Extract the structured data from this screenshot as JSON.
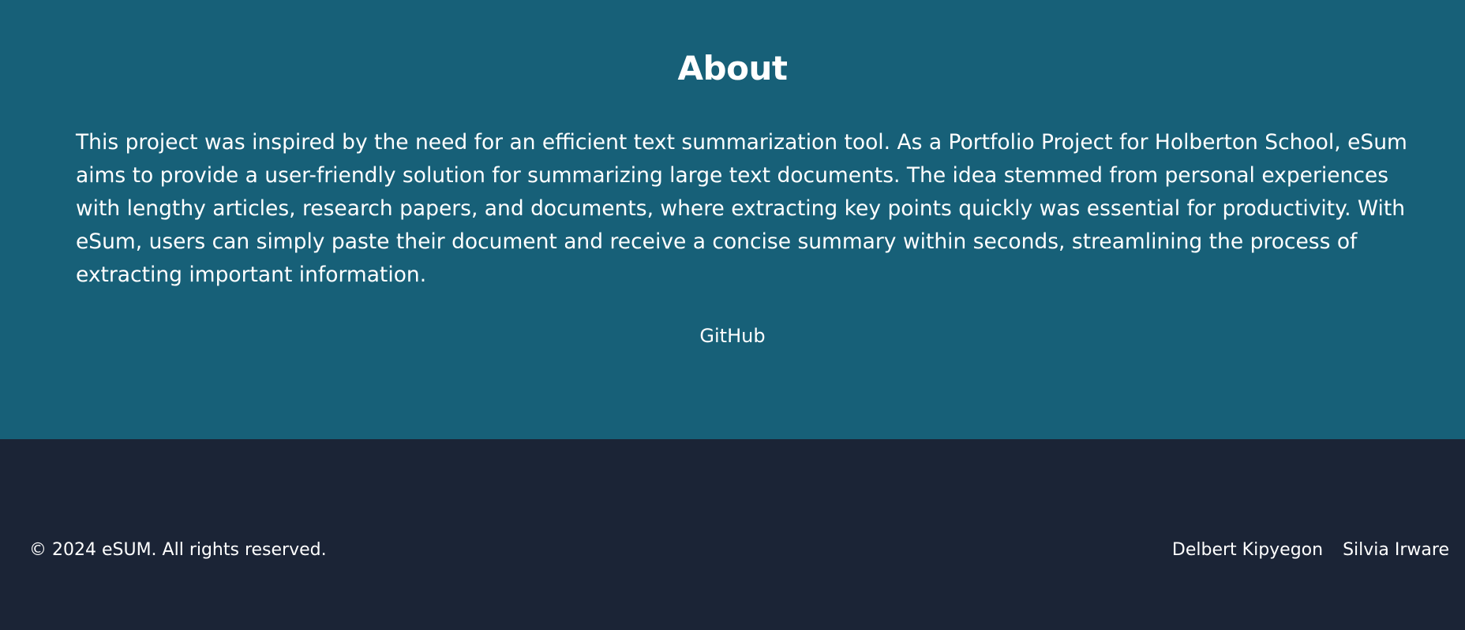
{
  "about": {
    "title": "About",
    "paragraph": "This project was inspired by the need for an efficient text summarization tool. As a Portfolio Project for Holberton School, eSum aims to provide a user-friendly solution for summarizing large text documents. The idea stemmed from personal experiences with lengthy articles, research papers, and documents, where extracting key points quickly was essential for productivity. With eSum, users can simply paste their document and receive a concise summary within seconds, streamlining the process of extracting important information.",
    "github_label": "GitHub"
  },
  "footer": {
    "copyright": "© 2024 eSUM. All rights reserved.",
    "authors": [
      "Delbert Kipyegon",
      "Silvia Irware"
    ]
  },
  "colors": {
    "about_background": "#176078",
    "footer_background": "#1b2436",
    "text": "#ffffff"
  }
}
